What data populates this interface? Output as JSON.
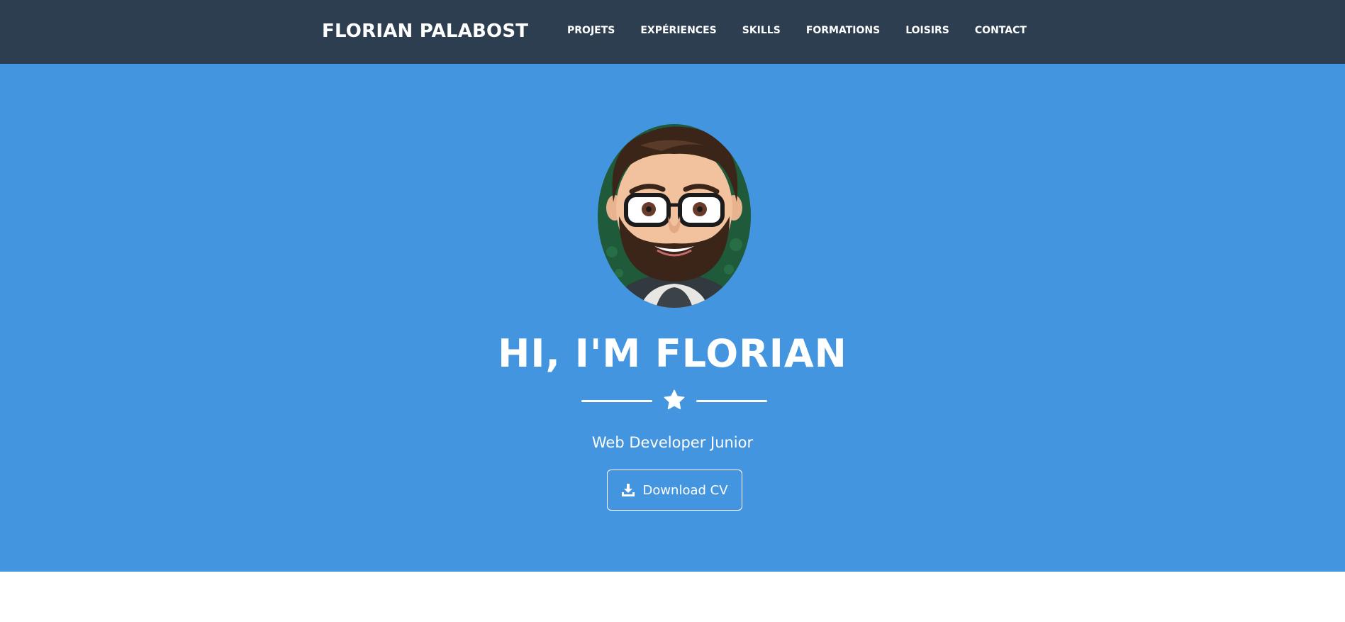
{
  "navbar": {
    "brand": "FLORIAN PALABOST",
    "links": [
      {
        "label": "PROJETS"
      },
      {
        "label": "EXPÉRIENCES"
      },
      {
        "label": "SKILLS"
      },
      {
        "label": "FORMATIONS"
      },
      {
        "label": "LOISIRS"
      },
      {
        "label": "CONTACT"
      }
    ]
  },
  "hero": {
    "title": "HI, I'M FLORIAN",
    "subtitle": "Web Developer Junior",
    "cv_button_label": "Download CV",
    "divider_icon": "star-icon",
    "cv_button_icon": "download-icon"
  },
  "colors": {
    "navbar_bg": "#2c3e50",
    "hero_bg": "#4495df",
    "text": "#ffffff"
  }
}
